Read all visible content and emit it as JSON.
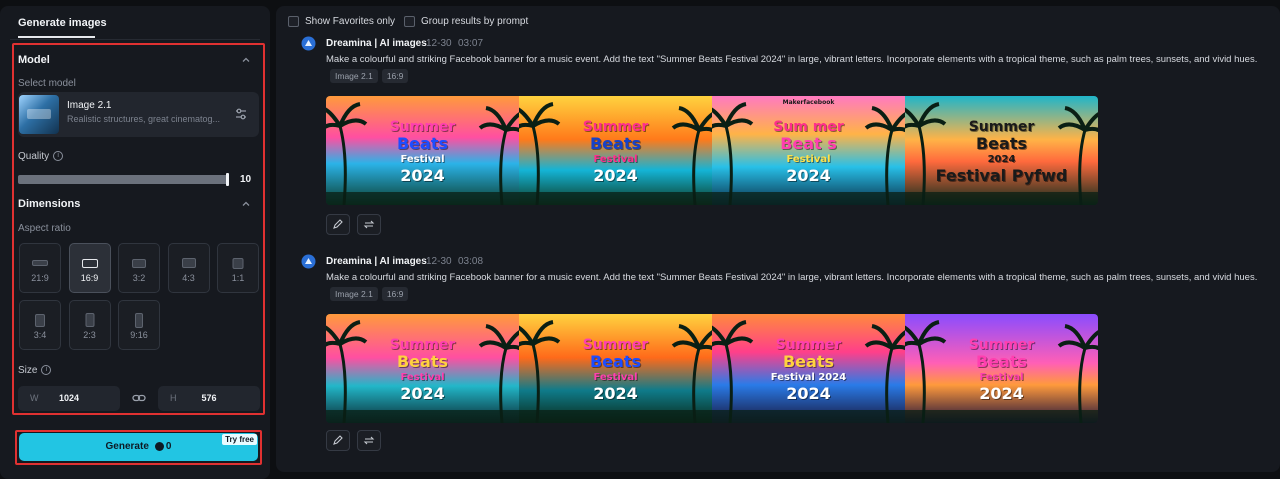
{
  "left_panel": {
    "tab_label": "Generate images",
    "model_section": {
      "title": "Model",
      "select_label": "Select model",
      "model_name": "Image 2.1",
      "model_desc": "Realistic structures, great cinematog..."
    },
    "quality": {
      "label": "Quality",
      "value": "10",
      "level": 1.0
    },
    "dimensions": {
      "title": "Dimensions",
      "aspect_label": "Aspect ratio",
      "ratios": [
        "21:9",
        "16:9",
        "3:2",
        "4:3",
        "1:1",
        "3:4",
        "2:3",
        "9:16"
      ],
      "selected": "16:9"
    },
    "size": {
      "label": "Size",
      "w_prefix": "W",
      "w_value": "1024",
      "h_prefix": "H",
      "h_value": "576"
    },
    "generate": {
      "label": "Generate",
      "credits": "0",
      "badge": "Try free"
    }
  },
  "toolbar": {
    "show_favorites": "Show Favorites only",
    "group_by_prompt": "Group results by prompt"
  },
  "generations": [
    {
      "author": "Dreamina | AI images",
      "date": "12-30",
      "time": "03:07",
      "prompt": "Make a colourful and striking Facebook banner for a music event. Add the text \"Summer Beats Festival 2024\" in large, vibrant letters. Incorporate elements with a tropical theme, such as palm trees, sunsets, and vivid hues.",
      "tags": [
        "Image 2.1",
        "16:9"
      ],
      "images": [
        {
          "l1": "Summer",
          "l2": "Beats",
          "l3": "Festival",
          "l4": "2024"
        },
        {
          "l1": "Summer",
          "l2": "Beats",
          "l3": "Festival",
          "l4": "2024"
        },
        {
          "l1": "Sum mer",
          "l2": "Beat s",
          "l3": "Festival",
          "l4": "2024",
          "top": "Makerfacebook"
        },
        {
          "l1": "Summer",
          "l2": "Beats",
          "l3": "2024",
          "l4": "Festival Pyfwd"
        }
      ]
    },
    {
      "author": "Dreamina | AI images",
      "date": "12-30",
      "time": "03:08",
      "prompt": "Make a colourful and striking Facebook banner for a music event. Add the text \"Summer Beats Festival 2024\" in large, vibrant letters. Incorporate elements with a tropical theme, such as palm trees, sunsets, and vivid hues.",
      "tags": [
        "Image 2.1",
        "16:9"
      ],
      "images": [
        {
          "l1": "Summer",
          "l2": "Beats",
          "l3": "Festival",
          "l4": "2024"
        },
        {
          "l1": "Summer",
          "l2": "Beats",
          "l3": "Festival",
          "l4": "2024"
        },
        {
          "l1": "Summer",
          "l2": "Beats",
          "l3": "Festival 2024",
          "l4": "2024"
        },
        {
          "l1": "Summer",
          "l2": "Beats",
          "l3": "Festival",
          "l4": "2024"
        }
      ]
    }
  ],
  "colors": {
    "accent": "#22c5e3",
    "highlight": "#e03131",
    "panel_bg": "#16191f"
  }
}
